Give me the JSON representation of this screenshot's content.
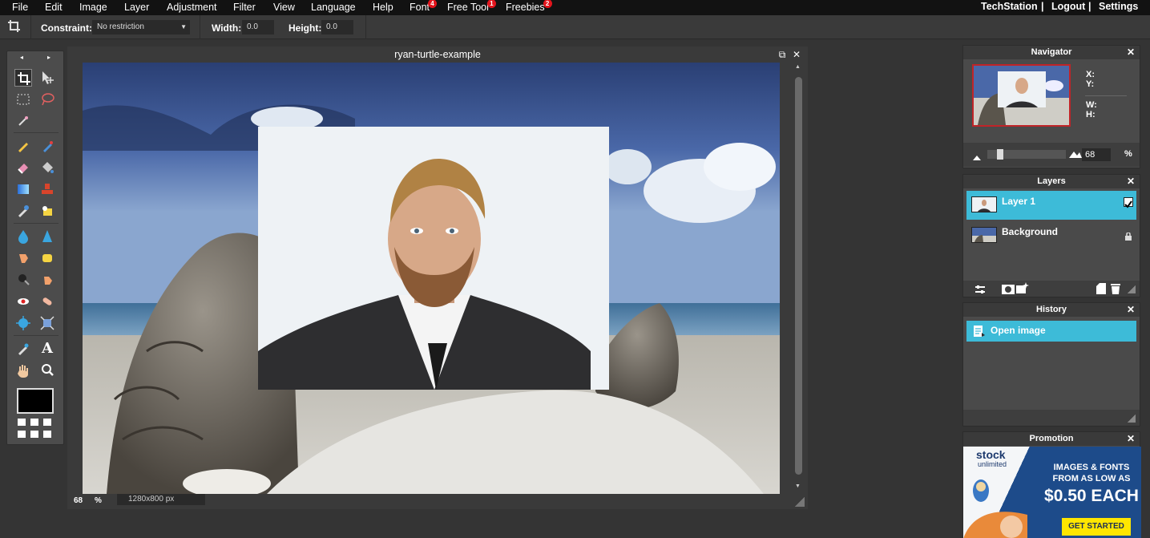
{
  "menubar": {
    "items": [
      {
        "label": "File"
      },
      {
        "label": "Edit"
      },
      {
        "label": "Image"
      },
      {
        "label": "Layer"
      },
      {
        "label": "Adjustment"
      },
      {
        "label": "Filter"
      },
      {
        "label": "View"
      },
      {
        "label": "Language"
      },
      {
        "label": "Help"
      },
      {
        "label": "Font",
        "badge": "4"
      },
      {
        "label": "Free Tool",
        "badge": "1"
      },
      {
        "label": "Freebies",
        "badge": "2"
      }
    ],
    "right": {
      "user": "TechStation",
      "sep": "|",
      "logout": "Logout",
      "settings": "Settings"
    }
  },
  "options": {
    "constraint_label": "Constraint:",
    "constraint_value": "No restriction",
    "width_label": "Width:",
    "width_value": "0.0",
    "height_label": "Height:",
    "height_value": "0.0"
  },
  "toolbox": {
    "prev": "◂",
    "next": "▸",
    "text_tool": "A"
  },
  "document": {
    "title": "ryan-turtle-example",
    "restore_glyph": "⧉",
    "close_glyph": "✕",
    "zoom": "68",
    "zoom_unit": "%",
    "size": "1280x800 px"
  },
  "navigator": {
    "title": "Navigator",
    "close_glyph": "✕",
    "x_label": "X:",
    "y_label": "Y:",
    "w_label": "W:",
    "h_label": "H:",
    "zoom": "68",
    "zoom_unit": "%",
    "zoom_fraction": 0.68
  },
  "layers": {
    "title": "Layers",
    "close_glyph": "✕",
    "items": [
      {
        "name": "Layer 1"
      },
      {
        "name": "Background"
      }
    ]
  },
  "history": {
    "title": "History",
    "close_glyph": "✕",
    "items": [
      {
        "label": "Open image"
      }
    ]
  },
  "promotion": {
    "title": "Promotion",
    "close_glyph": "✕",
    "brand_top": "stock",
    "brand_bottom": "unlimited",
    "line1": "IMAGES & FONTS",
    "line2": "FROM AS LOW AS",
    "price": "$0.50 EACH",
    "cta": "GET STARTED"
  },
  "colors": {
    "accent": "#3dbbd8",
    "badge": "#e3141c",
    "menubar": "#121212",
    "background": "#343434"
  }
}
